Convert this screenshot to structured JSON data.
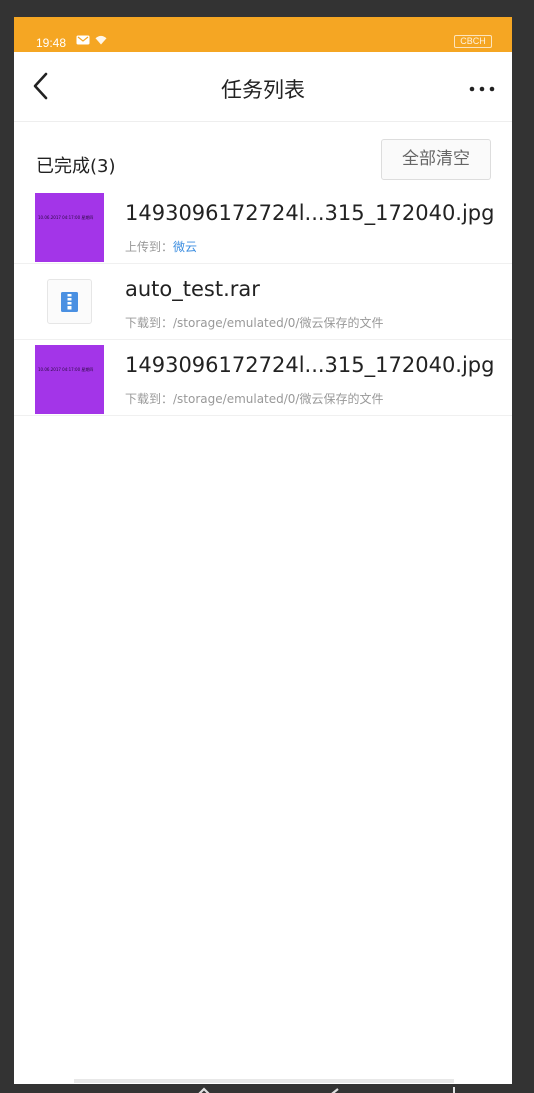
{
  "status_bar": {
    "time": "19:48",
    "icons": [
      "message-icon",
      "wifi-icon"
    ],
    "battery_label": "CBCH"
  },
  "nav": {
    "title": "任务列表",
    "back_icon": "chevron-left-icon",
    "more_icon": "more-dots-icon"
  },
  "section": {
    "title": "已完成(3)",
    "clear_label": "全部清空"
  },
  "tasks": [
    {
      "name": "1493096172724l...315_172040.jpg",
      "sub_label": "上传到：",
      "sub_value": "微云",
      "thumb": "image-thumbnail",
      "thumb_text": "10.06.2017 04:17:00 星期四"
    },
    {
      "name": "auto_test.rar",
      "sub_label": "下载到：",
      "sub_value": "/storage/emulated/0/微云保存的文件",
      "thumb": "archive-icon"
    },
    {
      "name": "1493096172724l...315_172040.jpg",
      "sub_label": "下载到：",
      "sub_value": "/storage/emulated/0/微云保存的文件",
      "thumb": "image-thumbnail",
      "thumb_text": "10.06.2017 04:17:00 星期四"
    }
  ],
  "system_nav": [
    "menu-icon",
    "home-icon",
    "back-icon",
    "power-icon"
  ],
  "colors": {
    "status_bar": "#f5a623",
    "upload_target": "#3d8ee0",
    "thumbnail": "#a335e8",
    "archive_icon": "#4a90e2"
  }
}
